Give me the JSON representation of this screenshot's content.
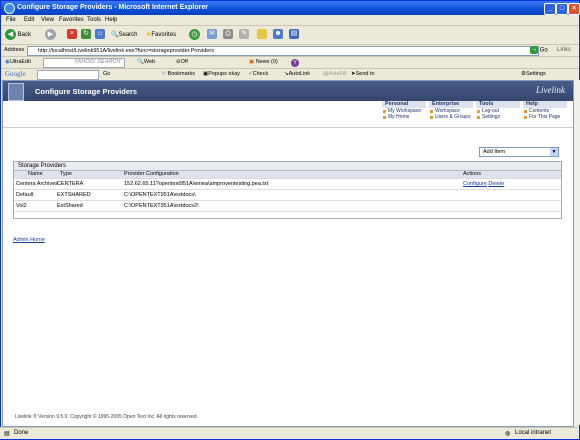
{
  "window": {
    "title": "Configure Storage Providers - Microsoft Internet Explorer"
  },
  "menu": [
    "File",
    "Edit",
    "View",
    "Favorites",
    "Tools",
    "Help"
  ],
  "toolbar": {
    "back": "Back",
    "search": "Search",
    "favorites": "Favorites"
  },
  "address": {
    "label": "Address",
    "url": "http://localhost/Livelink951A/livelink.exe?func=storageprovider.Providers",
    "go": "Go",
    "links": "Links"
  },
  "bar2": {
    "ultraedit": "UltraEdit",
    "yahoo": "YAHOO! SEARCH",
    "web": "Web",
    "off": "Off",
    "news": "News (0)"
  },
  "bar3": {
    "google": "Google",
    "go": "Go",
    "bookmarks": "Bookmarks",
    "popups": "Popups okay",
    "check": "Check",
    "autolink": "AutoLink",
    "autofill": "AutoFill",
    "sendto": "Send to",
    "settings": "Settings"
  },
  "header": {
    "title": "Configure Storage Providers",
    "brand": "Livelink"
  },
  "nav": [
    {
      "head": "Personal",
      "links": [
        "My Workspace",
        "My Home"
      ]
    },
    {
      "head": "Enterprise",
      "links": [
        "Workspace",
        "Users & Groups"
      ]
    },
    {
      "head": "Tools",
      "links": [
        "Log-out",
        "Settings"
      ]
    },
    {
      "head": "Help",
      "links": [
        "Contents",
        "For This Page"
      ]
    }
  ],
  "add_item": "Add Item",
  "table": {
    "caption": "Storage Providers",
    "columns": [
      "Name",
      "Type",
      "Provider Configuration",
      "Actions"
    ],
    "rows": [
      {
        "name": "Centera Archives",
        "type": "CENTERA",
        "config": "152.62.65.11?opentext951A\\emea\\amproventesting.pea.txt",
        "actions": [
          "Configure",
          "Delete"
        ]
      },
      {
        "name": "Default",
        "type": "EXTSHARED",
        "config": "C:\\OPENTEXT951A\\extdocs\\",
        "actions": []
      },
      {
        "name": "Vol2",
        "type": "ExtShared",
        "config": "C:\\OPENTEXT951A\\extdocs2\\",
        "actions": []
      }
    ]
  },
  "admin_home": "Admin Home",
  "copyright": "Livelink ® Version 9.5.0, Copyright © 1995-2005 Open Text Inc. All rights reserved.",
  "status": {
    "left": "Done",
    "zone": "Local intranet"
  }
}
